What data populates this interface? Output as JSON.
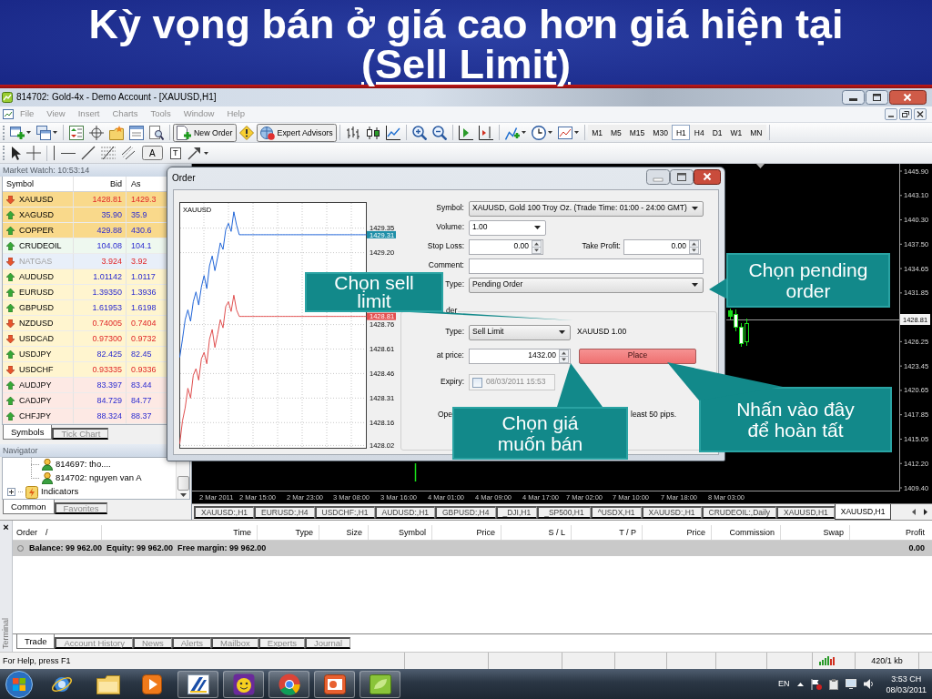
{
  "slide_title": {
    "line_1": "Kỳ vọng bán ở giá cao hơn giá hiện tại",
    "line_2": "(Sell Limit)"
  },
  "window": {
    "title": "814702: Gold-4x - Demo Account - [XAUUSD,H1]"
  },
  "menu": [
    {
      "label": "File",
      "disabled": true
    },
    {
      "label": "View",
      "disabled": true
    },
    {
      "label": "Insert",
      "disabled": true
    },
    {
      "label": "Charts",
      "disabled": true
    },
    {
      "label": "Tools",
      "disabled": true
    },
    {
      "label": "Window",
      "disabled": true
    },
    {
      "label": "Help",
      "disabled": true
    }
  ],
  "toolbar": {
    "new_order": "New Order",
    "expert_advisors": "Expert Advisors",
    "timeframes": [
      {
        "label": "M1",
        "selected": false
      },
      {
        "label": "M5",
        "selected": false
      },
      {
        "label": "M15",
        "selected": false
      },
      {
        "label": "M30",
        "selected": false
      },
      {
        "label": "H1",
        "selected": true
      },
      {
        "label": "H4",
        "selected": false
      },
      {
        "label": "D1",
        "selected": false
      },
      {
        "label": "W1",
        "selected": false
      },
      {
        "label": "MN",
        "selected": false
      }
    ]
  },
  "drawing_toolbar": {
    "text_tool": "A",
    "text_label_tool": "T"
  },
  "market_watch": {
    "title": "Market Watch: 10:53:14",
    "columns": [
      "Symbol",
      "Bid",
      "As"
    ],
    "rows": [
      {
        "symbol": "XAUUSD",
        "bid": "1428.81",
        "ask": "1429.3",
        "kind": "down",
        "color": "#f9d98b",
        "disabled": false
      },
      {
        "symbol": "XAGUSD",
        "bid": "35.90",
        "ask": "35.9",
        "kind": "up",
        "color": "#f9d98b",
        "disabled": false
      },
      {
        "symbol": "COPPER",
        "bid": "429.88",
        "ask": "430.6",
        "kind": "up",
        "color": "#f9d98b",
        "disabled": false
      },
      {
        "symbol": "CRUDEOIL",
        "bid": "104.08",
        "ask": "104.1",
        "kind": "up",
        "color": "#eef8ef",
        "disabled": false
      },
      {
        "symbol": "NATGAS",
        "bid": "3.924",
        "ask": "3.92",
        "kind": "down",
        "color": "#e8eff9",
        "disabled": true
      },
      {
        "symbol": "AUDUSD",
        "bid": "1.01142",
        "ask": "1.0117",
        "kind": "up",
        "color": "#fff5cf",
        "disabled": false
      },
      {
        "symbol": "EURUSD",
        "bid": "1.39350",
        "ask": "1.3936",
        "kind": "up",
        "color": "#fff5cf",
        "disabled": false
      },
      {
        "symbol": "GBPUSD",
        "bid": "1.61953",
        "ask": "1.6198",
        "kind": "up",
        "color": "#fff5cf",
        "disabled": false
      },
      {
        "symbol": "NZDUSD",
        "bid": "0.74005",
        "ask": "0.7404",
        "kind": "down",
        "color": "#fff5cf",
        "disabled": false
      },
      {
        "symbol": "USDCAD",
        "bid": "0.97300",
        "ask": "0.9732",
        "kind": "down",
        "color": "#fff5cf",
        "disabled": false
      },
      {
        "symbol": "USDJPY",
        "bid": "82.425",
        "ask": "82.45",
        "kind": "up",
        "color": "#fff5cf",
        "disabled": false
      },
      {
        "symbol": "USDCHF",
        "bid": "0.93335",
        "ask": "0.9336",
        "kind": "down",
        "color": "#fff5cf",
        "disabled": false
      },
      {
        "symbol": "AUDJPY",
        "bid": "83.397",
        "ask": "83.44",
        "kind": "up",
        "color": "#fde9e4",
        "disabled": false
      },
      {
        "symbol": "CADJPY",
        "bid": "84.729",
        "ask": "84.77",
        "kind": "up",
        "color": "#fde9e4",
        "disabled": false
      },
      {
        "symbol": "CHFJPY",
        "bid": "88.324",
        "ask": "88.37",
        "kind": "up",
        "color": "#fde9e4",
        "disabled": false
      }
    ],
    "tabs": [
      {
        "label": "Symbols",
        "selected": true
      },
      {
        "label": "Tick Chart",
        "selected": false
      }
    ]
  },
  "navigator": {
    "title": "Navigator",
    "items": [
      {
        "label": "814697: tho....",
        "kind": "account"
      },
      {
        "label": "814702: nguyen van A",
        "kind": "account"
      },
      {
        "label": "Indicators",
        "kind": "folder",
        "expanded": false
      }
    ],
    "tabs": [
      {
        "label": "Common",
        "selected": true
      },
      {
        "label": "Favorites",
        "selected": false
      }
    ]
  },
  "chart": {
    "price_labels": [
      "1445.90",
      "1443.10",
      "1440.30",
      "1437.50",
      "1434.65",
      "1431.85",
      "1426.25",
      "1423.45",
      "1420.65",
      "1417.85",
      "1415.05",
      "1412.20",
      "1409.40"
    ],
    "current_price": "1428.81",
    "time_labels": [
      "2 Mar 2011",
      "2 Mar 15:00",
      "2 Mar 23:00",
      "3 Mar 08:00",
      "3 Mar 16:00",
      "4 Mar 01:00",
      "4 Mar 09:00",
      "4 Mar 17:00",
      "7 Mar 02:00",
      "7 Mar 10:00",
      "7 Mar 18:00",
      "8 Mar 03:00"
    ]
  },
  "chart_tabs": [
    {
      "label": "XAUUSD:,H1",
      "selected": false
    },
    {
      "label": "EURUSD:,H4",
      "selected": false
    },
    {
      "label": "USDCHF:,H1",
      "selected": false
    },
    {
      "label": "AUDUSD:,H1",
      "selected": false
    },
    {
      "label": "GBPUSD:,H4",
      "selected": false
    },
    {
      "label": "_DJI,H1",
      "selected": false
    },
    {
      "label": "_SP500,H1",
      "selected": false
    },
    {
      "label": "^USDX,H1",
      "selected": false
    },
    {
      "label": "XAUUSD:,H1",
      "selected": false
    },
    {
      "label": "CRUDEOIL:,Daily",
      "selected": false
    },
    {
      "label": "XAUUSD,H1",
      "selected": false
    },
    {
      "label": "XAUUSD,H1",
      "selected": true
    }
  ],
  "order_dialog": {
    "title": "Order",
    "tick_chart": {
      "symbol": "XAUUSD",
      "ask": "1429.31",
      "bid": "1428.81",
      "chart_data": {
        "type": "line",
        "grid": true,
        "ylim": [
          1428.0,
          1429.51
        ],
        "yticks": [
          1429.35,
          {
            "value": 1429.2,
            "label": "1429.20"
          },
          1428.76,
          1428.61,
          1428.46,
          1428.31,
          1428.16,
          1428.02
        ],
        "series": [
          {
            "color": "#2266d8",
            "values": [
              1428.56,
              1428.67,
              1428.79,
              1428.85,
              1428.78,
              1428.9,
              1428.96,
              1428.88,
              1428.99,
              1429.06,
              1428.98,
              1429.12,
              1429.18,
              1429.09,
              1429.17,
              1429.26,
              1429.22,
              1429.34,
              1429.38,
              1429.33,
              1429.45,
              1429.37,
              1429.31,
              1429.31,
              1429.31,
              1429.31,
              1429.31,
              1429.31,
              1429.31,
              1429.31,
              1429.31,
              1429.31,
              1429.31,
              1429.31,
              1429.31,
              1429.31,
              1429.31,
              1429.31,
              1429.31,
              1429.31,
              1429.31,
              1429.31,
              1429.31,
              1429.31,
              1429.31,
              1429.31,
              1429.31,
              1429.31,
              1429.31,
              1429.31,
              1429.31,
              1429.31,
              1429.31,
              1429.31,
              1429.31,
              1429.31,
              1429.31,
              1429.31,
              1429.31,
              1429.31,
              1429.31,
              1429.31,
              1429.31,
              1429.31,
              1429.31,
              1429.31,
              1429.31,
              1429.31,
              1429.31,
              1429.31
            ]
          },
          {
            "color": "#e05050",
            "values": [
              1428.03,
              1428.17,
              1428.25,
              1428.37,
              1428.31,
              1428.45,
              1428.49,
              1428.42,
              1428.55,
              1428.59,
              1428.52,
              1428.67,
              1428.73,
              1428.62,
              1428.7,
              1428.79,
              1428.74,
              1428.87,
              1428.9,
              1428.84,
              1428.94,
              1428.85,
              1428.81,
              1428.81,
              1428.81,
              1428.81,
              1428.81,
              1428.81,
              1428.81,
              1428.81,
              1428.81,
              1428.81,
              1428.81,
              1428.81,
              1428.81,
              1428.81,
              1428.81,
              1428.81,
              1428.81,
              1428.81,
              1428.81,
              1428.81,
              1428.81,
              1428.81,
              1428.81,
              1428.81,
              1428.81,
              1428.81,
              1428.81,
              1428.81,
              1428.81,
              1428.81,
              1428.81,
              1428.81,
              1428.81,
              1428.81,
              1428.81,
              1428.81,
              1428.81,
              1428.81,
              1428.81,
              1428.81,
              1428.81,
              1428.81,
              1428.81,
              1428.81,
              1428.81,
              1428.81,
              1428.81,
              1428.81
            ]
          }
        ]
      }
    },
    "symbol": {
      "label": "Symbol:",
      "value": "XAUUSD, Gold 100 Troy Oz. (Trade Time: 01:00 - 24:00 GMT)"
    },
    "volume": {
      "label": "Volume:",
      "value": "1.00"
    },
    "stop_loss": {
      "label": "Stop Loss:",
      "value": "0.00"
    },
    "take_profit": {
      "label": "Take Profit:",
      "value": "0.00"
    },
    "comment": {
      "label": "Comment:"
    },
    "type": {
      "label": "Type:",
      "value": "Pending Order"
    },
    "pending": {
      "group_label": "der",
      "type": {
        "label": "Type:",
        "value": "Sell Limit"
      },
      "summary": "XAUUSD 1.00",
      "price": {
        "label": "at price:",
        "value": "1432.00"
      },
      "place_button": "Place",
      "expiry": {
        "label": "Expiry:",
        "checked": false,
        "value": "08/03/2011 15:53"
      },
      "note_visible_parts": [
        "Ope",
        "least 50 pips."
      ]
    }
  },
  "callouts": [
    {
      "text": "Chọn sell limit"
    },
    {
      "text": "Chọn pending order"
    },
    {
      "text": "Chọn giá muốn bán"
    },
    {
      "text": "Nhấn vào đây để hoàn tất"
    }
  ],
  "terminal": {
    "close_glyph": "×",
    "side_label": "Terminal",
    "columns": [
      "Order",
      "Time",
      "Type",
      "Size",
      "Symbol",
      "Price",
      "S / L",
      "T / P",
      "Price",
      "Commission",
      "Swap",
      "Profit"
    ],
    "sort_mark": "/",
    "balance": "Balance: 99 962.00  Equity: 99 962.00  Free margin: 99 962.00",
    "profit": "0.00",
    "tabs": [
      {
        "label": "Trade",
        "selected": true
      },
      {
        "label": "Account History",
        "selected": false
      },
      {
        "label": "News",
        "selected": false
      },
      {
        "label": "Alerts",
        "selected": false
      },
      {
        "label": "Mailbox",
        "selected": false
      },
      {
        "label": "Experts",
        "selected": false
      },
      {
        "label": "Journal",
        "selected": false
      }
    ]
  },
  "status_bar": {
    "help": "For Help, press F1",
    "traffic": "420/1 kb"
  },
  "taskbar": {
    "language": "EN",
    "time": "3:53 CH",
    "date": "08/03/2011"
  }
}
